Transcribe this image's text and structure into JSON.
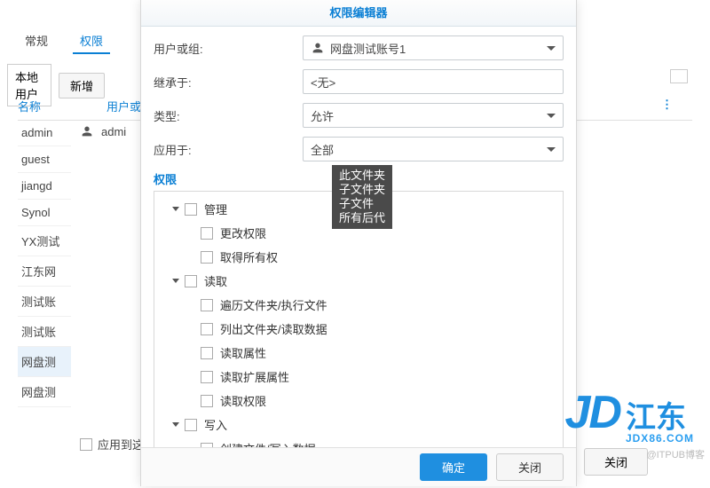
{
  "bg": {
    "tabs": {
      "general": "常规",
      "perm": "权限"
    },
    "local_user": "本地用户",
    "add": "新增",
    "col_name": "名称",
    "col_user": "用户或组",
    "more": "⋮",
    "users": [
      "admin",
      "guest",
      "jiangd",
      "Synol",
      "YX测试",
      "江东网",
      "测试账",
      "测试账",
      "网盘测",
      "网盘测"
    ],
    "row_user": "admi",
    "apply_to": "应用到这",
    "close": "关闭"
  },
  "modal": {
    "title": "权限编辑器",
    "fields": {
      "user_label": "用户或组:",
      "user_value": "网盘测试账号1",
      "inherit_label": "继承于:",
      "inherit_value": "<无>",
      "type_label": "类型:",
      "type_value": "允许",
      "apply_label": "应用于:",
      "apply_value": "全部"
    },
    "section": "权限",
    "groups": {
      "manage": {
        "label": "管理",
        "items": [
          "更改权限",
          "取得所有权"
        ]
      },
      "read": {
        "label": "读取",
        "items": [
          "遍历文件夹/执行文件",
          "列出文件夹/读取数据",
          "读取属性",
          "读取扩展属性",
          "读取权限"
        ]
      },
      "write": {
        "label": "写入",
        "items": [
          "创建文件/写入数据",
          ""
        ]
      }
    },
    "tooltip": {
      "l1": "此文件夹",
      "l2": "子文件夹",
      "l3": "子文件",
      "l4": "所有后代"
    },
    "ok": "确定",
    "close": "关闭"
  },
  "watermark": {
    "jd": "JD",
    "cn": "江东",
    "en": "JDX86.COM",
    "credit": "@ITPUB博客"
  }
}
